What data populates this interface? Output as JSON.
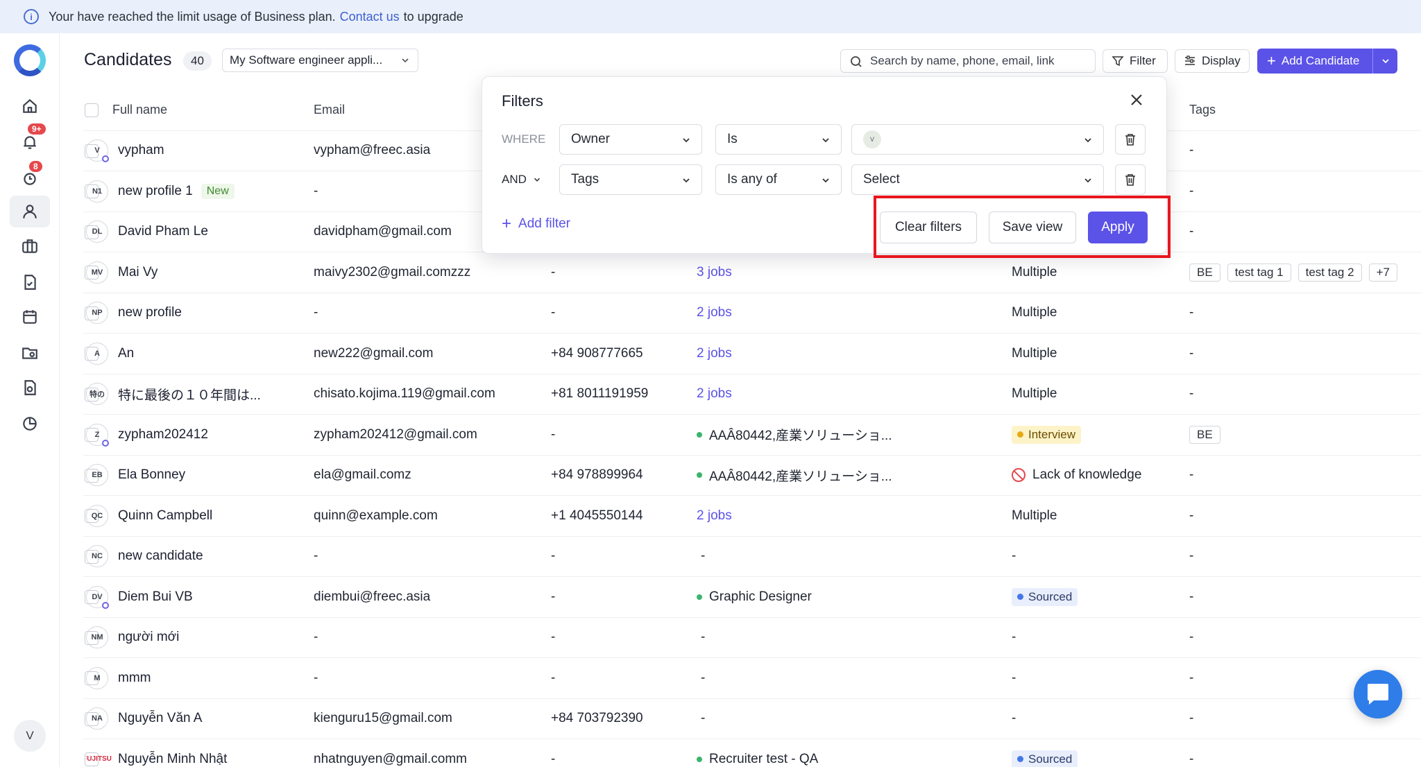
{
  "banner": {
    "prefix": "Your have reached the limit usage of Business plan.",
    "link": "Contact us",
    "suffix": "to upgrade"
  },
  "sidebar": {
    "notification_badge": "9+",
    "activity_badge": "8",
    "user_initial": "V"
  },
  "header": {
    "title": "Candidates",
    "count": "40",
    "view_select": "My Software engineer appli...",
    "search_placeholder": "Search by name, phone, email, link",
    "filter_label": "Filter",
    "display_label": "Display",
    "add_label": "Add Candidate"
  },
  "columns": {
    "name": "Full name",
    "email": "Email",
    "tags": "Tags"
  },
  "rows": [
    {
      "initials": "V",
      "name": "vypham",
      "email": "vypham@freec.asia",
      "phone": "",
      "jobs": "",
      "stage": "",
      "tags": [
        "-"
      ],
      "dot": true
    },
    {
      "initials": "N1",
      "name": "new profile 1",
      "new_tag": "New",
      "email": "-",
      "phone": "",
      "jobs": "",
      "stage": "",
      "tags": [
        "-"
      ]
    },
    {
      "initials": "DL",
      "name": "David Pham Le",
      "email": "davidpham@gmail.com",
      "phone": "",
      "jobs": "",
      "stage": "",
      "tags": [
        "-"
      ]
    },
    {
      "initials": "MV",
      "name": "Mai Vy",
      "email": "maivy2302@gmail.comzzz",
      "phone": "-",
      "jobs": "3 jobs",
      "stage": "Multiple",
      "tags": [
        "BE",
        "test tag 1",
        "test tag 2",
        "+7"
      ]
    },
    {
      "initials": "NP",
      "name": "new profile",
      "email": "-",
      "phone": "-",
      "jobs": "2 jobs",
      "stage": "Multiple",
      "tags": [
        "-"
      ]
    },
    {
      "initials": "A",
      "name": "An",
      "email": "new222@gmail.com",
      "phone": "+84 908777665",
      "jobs": "2 jobs",
      "stage": "Multiple",
      "tags": [
        "-"
      ]
    },
    {
      "initials": "特の",
      "name": "特に最後の１０年間は...",
      "email": "chisato.kojima.119@gmail.com",
      "phone": "+81 8011191959",
      "jobs": "2 jobs",
      "stage": "Multiple",
      "tags": [
        "-"
      ]
    },
    {
      "initials": "Z",
      "name": "zypham202412",
      "email": "zypham202412@gmail.com",
      "phone": "-",
      "job_title": "AAÂ80442,産業ソリューショ...",
      "stage_pill": "Interview",
      "stage_kind": "interview",
      "tags": [
        "BE"
      ],
      "dot": true
    },
    {
      "initials": "EB",
      "name": "Ela Bonney",
      "email": "ela@gmail.comz",
      "phone": "+84 978899964",
      "job_title": "AAÂ80442,産業ソリューショ...",
      "stage_ban": "Lack of knowledge",
      "tags": [
        "-"
      ]
    },
    {
      "initials": "QC",
      "name": "Quinn Campbell",
      "email": "quinn@example.com",
      "phone": "+1 4045550144",
      "jobs": "2 jobs",
      "stage": "Multiple",
      "tags": [
        "-"
      ]
    },
    {
      "initials": "NC",
      "name": "new candidate",
      "email": "-",
      "phone": "-",
      "jobs_plain": "-",
      "stage": "-",
      "tags": [
        "-"
      ]
    },
    {
      "initials": "DV",
      "name": "Diem Bui VB",
      "email": "diembui@freec.asia",
      "phone": "-",
      "job_title": "Graphic Designer",
      "stage_pill": "Sourced",
      "stage_kind": "sourced",
      "tags": [
        "-"
      ],
      "dot": true
    },
    {
      "initials": "NM",
      "name": "người mới",
      "email": "-",
      "phone": "-",
      "jobs_plain": "-",
      "stage": "-",
      "tags": [
        "-"
      ]
    },
    {
      "initials": "M",
      "name": "mmm",
      "email": "-",
      "phone": "-",
      "jobs_plain": "-",
      "stage": "-",
      "tags": [
        "-"
      ]
    },
    {
      "initials": "NA",
      "name": "Nguyễn Văn A",
      "email": "kienguru15@gmail.com",
      "phone": "+84 703792390",
      "jobs_plain": "-",
      "stage": "-",
      "tags": [
        "-"
      ]
    },
    {
      "initials": "FUJITSU",
      "fujitsu": true,
      "name": "Nguyễn Minh Nhật",
      "email": "nhatnguyen@gmail.comm",
      "phone": "-",
      "job_title": "Recruiter test - QA",
      "stage_pill": "Sourced",
      "stage_kind": "sourced",
      "tags": [
        "-"
      ]
    }
  ],
  "filters": {
    "title": "Filters",
    "row1": {
      "label": "WHERE",
      "field": "Owner",
      "operator": "Is",
      "value_avatar": "V"
    },
    "row2": {
      "label": "AND",
      "field": "Tags",
      "operator": "Is any of",
      "value": "Select"
    },
    "add_filter": "Add filter",
    "clear": "Clear filters",
    "save": "Save view",
    "apply": "Apply"
  }
}
